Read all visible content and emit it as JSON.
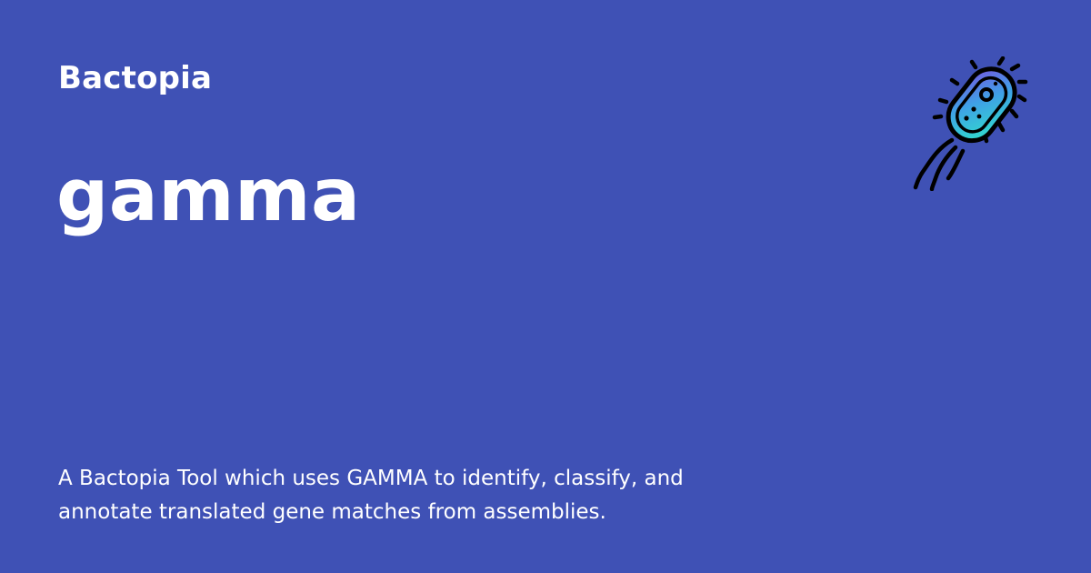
{
  "header": {
    "site_name": "Bactopia"
  },
  "main": {
    "title": "gamma",
    "description": "A Bactopia Tool which uses GAMMA to identify, classify, and annotate translated gene matches from assemblies."
  },
  "logo": {
    "icon": "bacterium-icon",
    "gradient_start": "#7b4fe0",
    "gradient_end": "#2ee6c8",
    "outline": "#000000"
  },
  "colors": {
    "background": "#3f51b5",
    "text": "#ffffff"
  }
}
